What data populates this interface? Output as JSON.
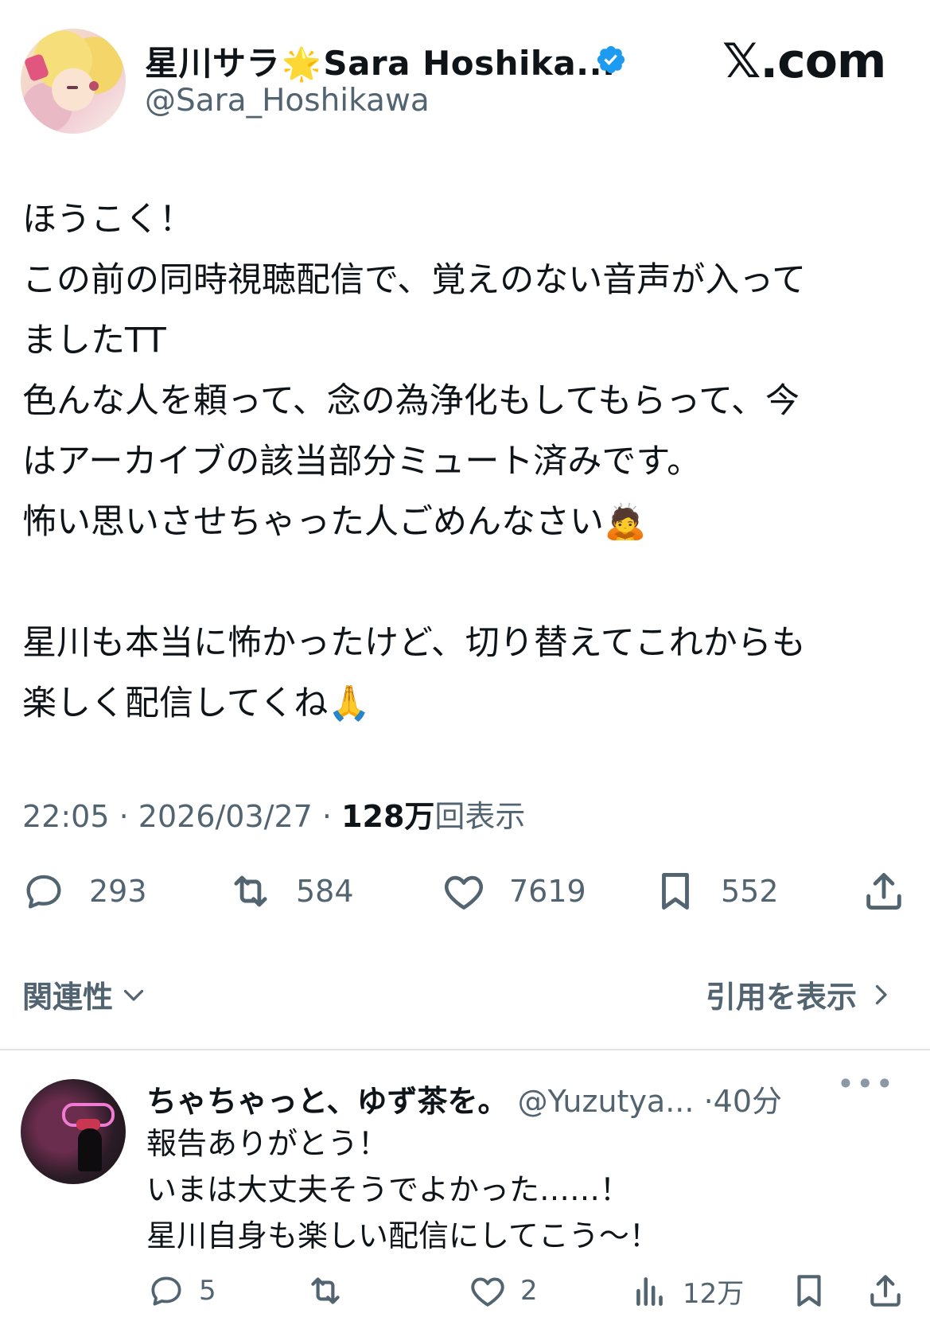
{
  "author": {
    "display_name": "星川サラ",
    "display_name_suffix": "Sara Hoshika...",
    "handle": "@Sara_Hoshikawa",
    "verified": true
  },
  "site_logo": "𝕏.com",
  "tweet": {
    "text": "ほうこく！\nこの前の同時視聴配信で、覚えのない音声が入って\nましたTT\n色んな人を頼って、念の為浄化もしてもらって、今\nはアーカイブの該当部分ミュート済みです。\n怖い思いさせちゃった人ごめんなさい🙇\n\n星川も本当に怖かったけど、切り替えてこれからも\n楽しく配信してくね🙏",
    "time": "22:05",
    "date": "2026/03/27",
    "views_count": "128万",
    "views_label": "回表示"
  },
  "actions": {
    "replies": "293",
    "retweets": "584",
    "likes": "7619",
    "bookmarks": "552"
  },
  "sort_label": "関連性",
  "quotes_label": "引用を表示",
  "reply": {
    "name": "ちゃちゃっと、ゆず茶を。",
    "handle": "@Yuzutya...",
    "time": "40分",
    "text": "報告ありがとう！\nいまは大丈夫そうでよかった……！\n星川自身も楽しい配信にしてこう〜！",
    "replies": "5",
    "retweets": "",
    "likes": "2",
    "views": "12万"
  },
  "colors": {
    "text": "#0f1419",
    "muted": "#536471",
    "verified": "#1d9bf0",
    "star": "#f5b700"
  },
  "icons": [
    "star-icon",
    "verified-badge-icon",
    "reply-icon",
    "retweet-icon",
    "like-icon",
    "bookmark-icon",
    "share-icon",
    "chevron-down-icon",
    "chevron-right-icon",
    "more-icon",
    "views-icon"
  ]
}
